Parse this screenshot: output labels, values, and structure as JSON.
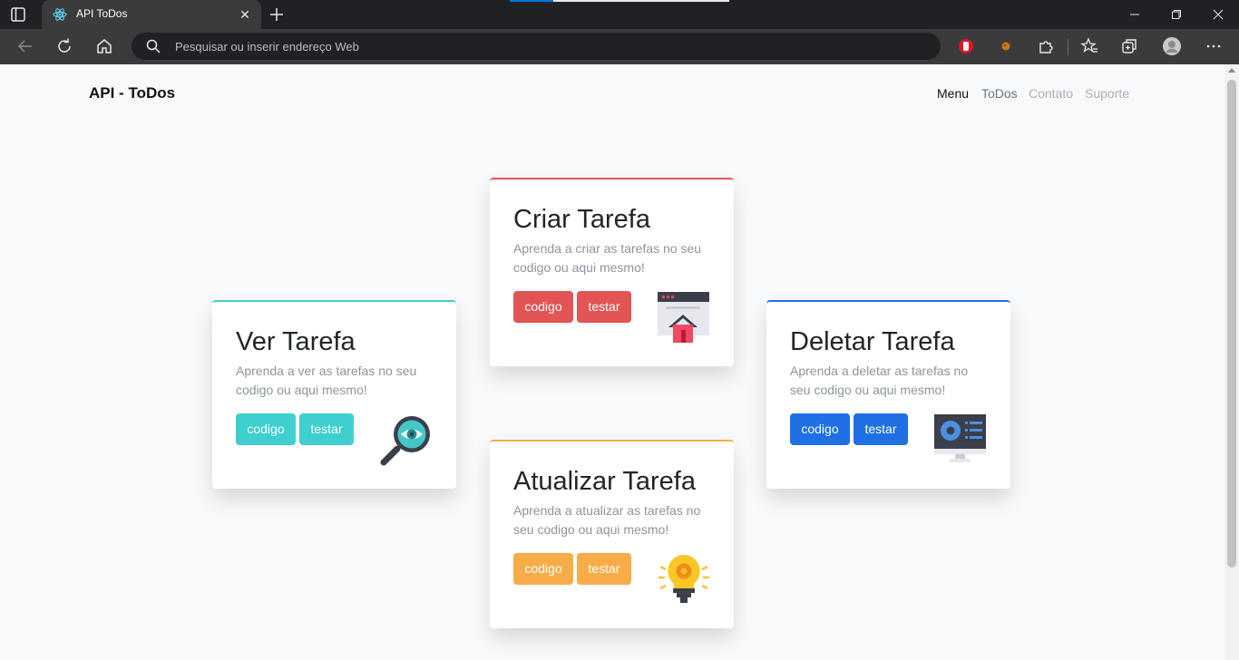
{
  "browser": {
    "tab_title": "API ToDos",
    "address_placeholder": "Pesquisar ou inserir endereço Web"
  },
  "navbar": {
    "brand": "API - ToDos",
    "links": [
      "Menu",
      "ToDos",
      "Contato",
      "Suporte"
    ]
  },
  "cards": [
    {
      "title": "Criar Tarefa",
      "text": "Aprenda a criar as tarefas no seu codigo ou aqui mesmo!",
      "code_label": "codigo",
      "test_label": "testar",
      "color": "#e35454"
    },
    {
      "title": "Ver Tarefa",
      "text": "Aprenda a ver as tarefas no seu codigo ou aqui mesmo!",
      "code_label": "codigo",
      "test_label": "testar",
      "color": "#3fcfcf"
    },
    {
      "title": "Deletar Tarefa",
      "text": "Aprenda a deletar as tarefas no seu codigo ou aqui mesmo!",
      "code_label": "codigo",
      "test_label": "testar",
      "color": "#1f6fe5"
    },
    {
      "title": "Atualizar Tarefa",
      "text": "Aprenda a atualizar as tarefas no seu codigo ou aqui mesmo!",
      "code_label": "codigo",
      "test_label": "testar",
      "color": "#f7ac48"
    }
  ],
  "icons": {
    "tab_favicon": "react-icon",
    "card_create": "house-window-icon",
    "card_view": "magnifier-eye-icon",
    "card_delete": "monitor-settings-icon",
    "card_update": "lightbulb-gear-icon"
  }
}
